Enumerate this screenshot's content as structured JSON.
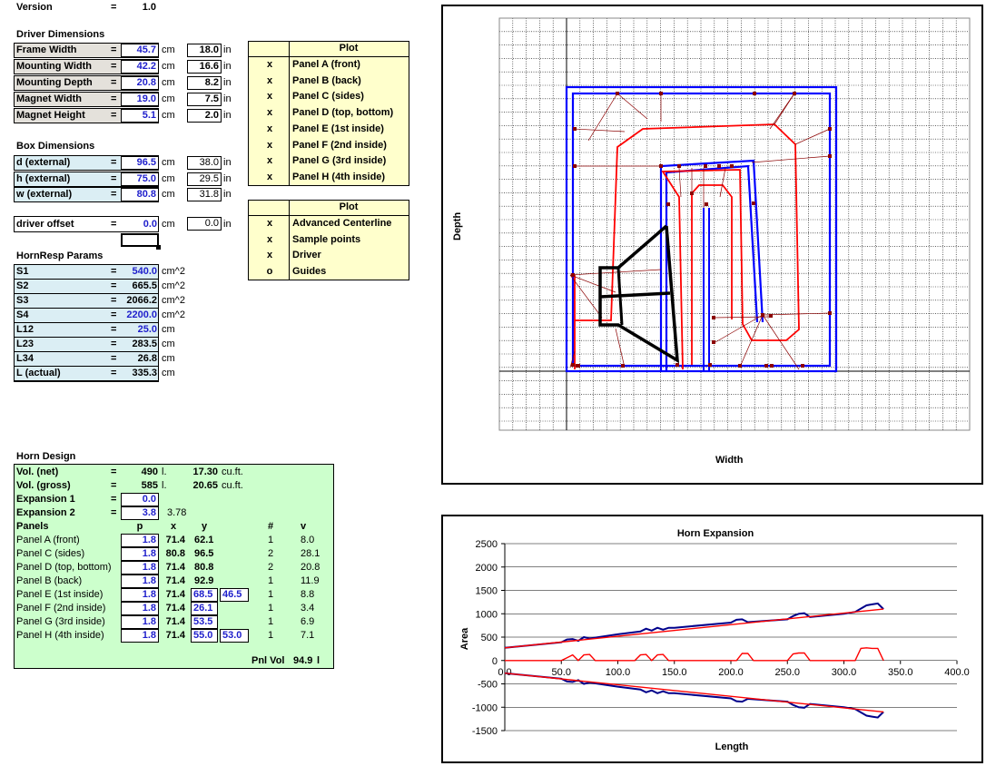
{
  "version": {
    "label": "Version",
    "eq": "=",
    "value": "1.0"
  },
  "driver": {
    "title": "Driver Dimensions",
    "rows": [
      {
        "label": "Frame Width",
        "cm": "45.7",
        "in": "18.0"
      },
      {
        "label": "Mounting Width",
        "cm": "42.2",
        "in": "16.6"
      },
      {
        "label": "Mounting Depth",
        "cm": "20.8",
        "in": "8.2"
      },
      {
        "label": "Magnet Width",
        "cm": "19.0",
        "in": "7.5"
      },
      {
        "label": "Magnet Height",
        "cm": "5.1",
        "in": "2.0"
      }
    ]
  },
  "units": {
    "cm": "cm",
    "in": "in",
    "cm2": "cm^2",
    "eq": "="
  },
  "box": {
    "title": "Box Dimensions",
    "rows": [
      {
        "label": "d (external)",
        "cm": "96.5",
        "in": "38.0"
      },
      {
        "label": "h (external)",
        "cm": "75.0",
        "in": "29.5"
      },
      {
        "label": "w (external)",
        "cm": "80.8",
        "in": "31.8"
      }
    ]
  },
  "offset": {
    "label": "driver offset",
    "cm": "0.0",
    "in": "0.0"
  },
  "hornresp": {
    "title": "HornResp Params",
    "rows": [
      {
        "label": "S1",
        "value": "540.0",
        "unit": "cm^2",
        "hl": true
      },
      {
        "label": "S2",
        "value": "665.5",
        "unit": "cm^2",
        "hl": false
      },
      {
        "label": "S3",
        "value": "2066.2",
        "unit": "cm^2",
        "hl": false
      },
      {
        "label": "S4",
        "value": "2200.0",
        "unit": "cm^2",
        "hl": true
      },
      {
        "label": "L12",
        "value": "25.0",
        "unit": "cm",
        "hl": true
      },
      {
        "label": "L23",
        "value": "283.5",
        "unit": "cm",
        "hl": false
      },
      {
        "label": "L34",
        "value": "26.8",
        "unit": "cm",
        "hl": false
      },
      {
        "label": "L (actual)",
        "value": "335.3",
        "unit": "cm",
        "hl": false
      }
    ]
  },
  "plot1": {
    "header": "Plot",
    "rows": [
      {
        "flag": "x",
        "label": "Panel A (front)"
      },
      {
        "flag": "x",
        "label": "Panel B (back)"
      },
      {
        "flag": "x",
        "label": "Panel C (sides)"
      },
      {
        "flag": "x",
        "label": "Panel D (top, bottom)"
      },
      {
        "flag": "x",
        "label": "Panel E (1st inside)"
      },
      {
        "flag": "x",
        "label": "Panel F (2nd inside)"
      },
      {
        "flag": "x",
        "label": "Panel G (3rd inside)"
      },
      {
        "flag": "x",
        "label": "Panel H (4th inside)"
      }
    ]
  },
  "plot2": {
    "header": "Plot",
    "rows": [
      {
        "flag": "x",
        "label": "Advanced Centerline"
      },
      {
        "flag": "x",
        "label": "Sample points"
      },
      {
        "flag": "x",
        "label": "Driver"
      },
      {
        "flag": "o",
        "label": "Guides"
      }
    ]
  },
  "horn": {
    "title": "Horn Design",
    "vol_net": {
      "label": "Vol. (net)",
      "l": "490",
      "lu": "l.",
      "ft": "17.30",
      "ftu": "cu.ft."
    },
    "vol_gross": {
      "label": "Vol. (gross)",
      "l": "585",
      "lu": "l.",
      "ft": "20.65",
      "ftu": "cu.ft."
    },
    "exp1": {
      "label": "Expansion 1",
      "value": "0.0"
    },
    "exp2": {
      "label": "Expansion 2",
      "value": "3.8",
      "extra": "3.78"
    },
    "headers": {
      "panels": "Panels",
      "p": "p",
      "x": "x",
      "y": "y",
      "n": "#",
      "v": "v"
    },
    "panels": [
      {
        "name": "Panel A (front)",
        "p": "1.8",
        "x": "71.4",
        "y": "62.1",
        "y2": "",
        "n": "1",
        "v": "8.0"
      },
      {
        "name": "Panel C (sides)",
        "p": "1.8",
        "x": "80.8",
        "y": "96.5",
        "y2": "",
        "n": "2",
        "v": "28.1"
      },
      {
        "name": "Panel D (top, bottom)",
        "p": "1.8",
        "x": "71.4",
        "y": "80.8",
        "y2": "",
        "n": "2",
        "v": "20.8"
      },
      {
        "name": "Panel B (back)",
        "p": "1.8",
        "x": "71.4",
        "y": "92.9",
        "y2": "",
        "n": "1",
        "v": "11.9"
      },
      {
        "name": "Panel E (1st inside)",
        "p": "1.8",
        "x": "71.4",
        "y": "68.5",
        "y2": "46.5",
        "n": "1",
        "v": "8.8"
      },
      {
        "name": "Panel F (2nd inside)",
        "p": "1.8",
        "x": "71.4",
        "y": "26.1",
        "y2": "",
        "n": "1",
        "v": "3.4"
      },
      {
        "name": "Panel G (3rd inside)",
        "p": "1.8",
        "x": "71.4",
        "y": "53.5",
        "y2": "",
        "n": "1",
        "v": "6.9"
      },
      {
        "name": "Panel H (4th inside)",
        "p": "1.8",
        "x": "71.4",
        "y": "55.0",
        "y2": "53.0",
        "n": "1",
        "v": "7.1"
      }
    ],
    "pnl_vol": {
      "label": "Pnl Vol",
      "value": "94.9",
      "unit": "l"
    }
  },
  "top_chart": {
    "xlabel": "Width",
    "ylabel": "Depth"
  },
  "chart_data": {
    "type": "line",
    "title": "Horn Expansion",
    "xlabel": "Length",
    "ylabel": "Area",
    "xlim": [
      0,
      400
    ],
    "ylim": [
      -1500,
      2500
    ],
    "xticks": [
      "0.0",
      "50.0",
      "100.0",
      "150.0",
      "200.0",
      "250.0",
      "300.0",
      "350.0",
      "400.0"
    ],
    "yticks": [
      "2500",
      "2000",
      "1500",
      "1000",
      "500",
      "0",
      "-500",
      "-1000",
      "-1500"
    ],
    "grid": true,
    "series": [
      {
        "color": "#00008b",
        "x": [
          0,
          50,
          55,
          60,
          65,
          70,
          75,
          100,
          120,
          125,
          130,
          135,
          140,
          145,
          150,
          200,
          205,
          210,
          215,
          250,
          255,
          260,
          265,
          270,
          300,
          310,
          320,
          325,
          330,
          335
        ],
        "y": [
          270,
          390,
          450,
          460,
          420,
          500,
          470,
          560,
          620,
          680,
          640,
          700,
          660,
          700,
          700,
          810,
          870,
          880,
          820,
          880,
          950,
          1000,
          1010,
          930,
          1000,
          1040,
          1180,
          1200,
          1220,
          1100
        ]
      },
      {
        "color": "#ff0000",
        "x": [
          0,
          335
        ],
        "y": [
          270,
          1100
        ]
      },
      {
        "color": "#ff0000",
        "x": [
          0,
          50,
          55,
          60,
          65,
          70,
          75,
          80,
          115,
          120,
          125,
          130,
          135,
          140,
          145,
          205,
          210,
          215,
          220,
          250,
          255,
          260,
          265,
          270,
          310,
          315,
          320,
          325,
          330,
          335
        ],
        "y": [
          0,
          0,
          60,
          120,
          0,
          120,
          130,
          0,
          0,
          120,
          130,
          0,
          120,
          130,
          0,
          0,
          150,
          150,
          0,
          0,
          140,
          160,
          160,
          0,
          0,
          260,
          270,
          260,
          260,
          0
        ]
      },
      {
        "color": "#00008b",
        "x": [
          0,
          50,
          55,
          60,
          65,
          70,
          75,
          100,
          120,
          125,
          130,
          135,
          140,
          145,
          150,
          200,
          205,
          210,
          215,
          250,
          255,
          260,
          265,
          270,
          300,
          310,
          320,
          325,
          330,
          335
        ],
        "y": [
          -270,
          -390,
          -450,
          -460,
          -420,
          -500,
          -470,
          -560,
          -620,
          -680,
          -640,
          -700,
          -660,
          -700,
          -700,
          -810,
          -870,
          -880,
          -820,
          -880,
          -950,
          -1000,
          -1010,
          -930,
          -1000,
          -1040,
          -1180,
          -1200,
          -1220,
          -1100
        ]
      },
      {
        "color": "#ff0000",
        "x": [
          0,
          335
        ],
        "y": [
          -270,
          -1100
        ]
      }
    ]
  }
}
